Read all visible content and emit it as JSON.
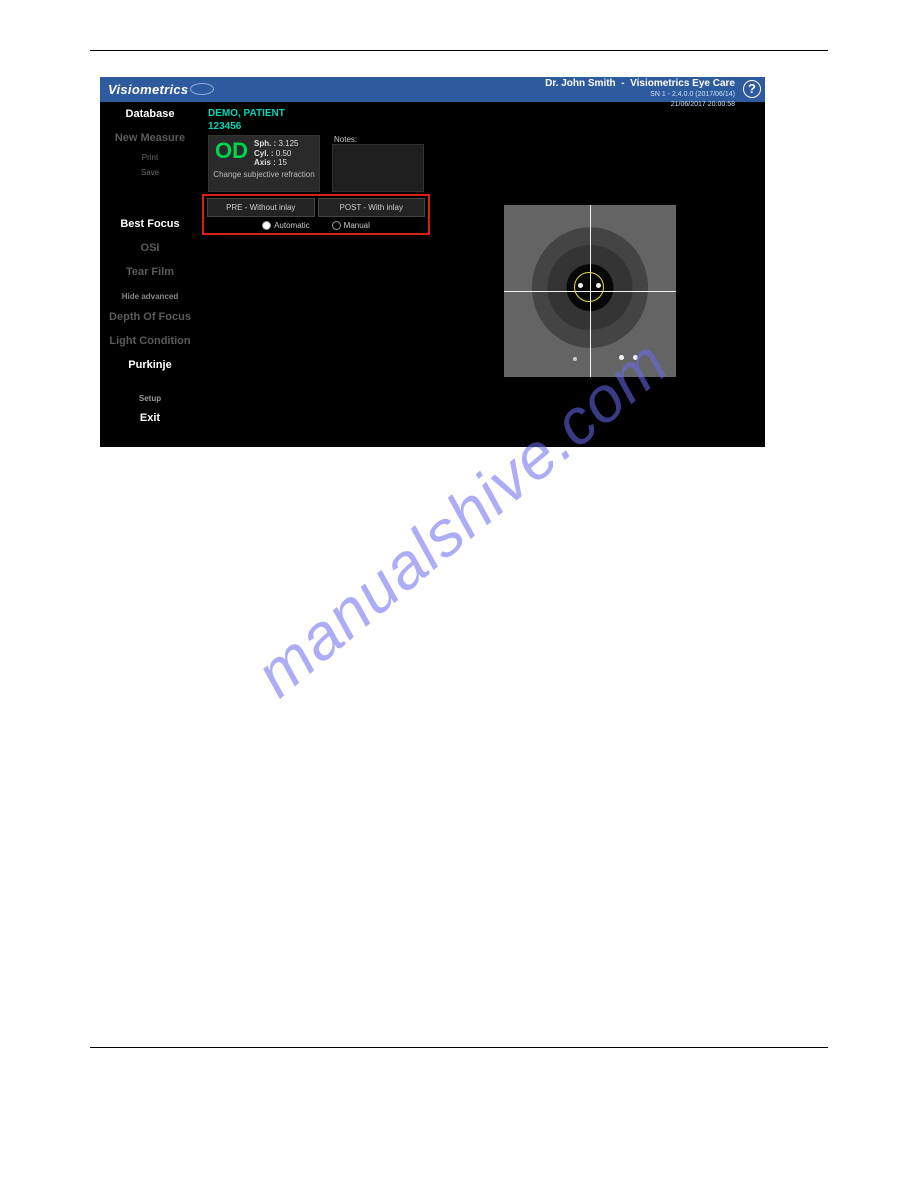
{
  "titlebar": {
    "brand": "Visiometrics",
    "doctor": "Dr. John Smith",
    "clinic": "Visiometrics Eye Care",
    "version": "SN 1 - 2.4.0.0 (2017/06/14)",
    "datetime": "21/06/2017 20:00:58"
  },
  "sidebar": {
    "database": "Database",
    "new_measure": "New Measure",
    "print": "Print",
    "save": "Save",
    "best_focus": "Best Focus",
    "osi": "OSI",
    "tear_film": "Tear Film",
    "hide_advanced": "Hide advanced",
    "depth_of_focus": "Depth Of Focus",
    "light_condition": "Light Condition",
    "purkinje": "Purkinje",
    "setup": "Setup",
    "exit": "Exit"
  },
  "patient": {
    "name": "DEMO, PATIENT",
    "id": "123456"
  },
  "refraction": {
    "eye": "OD",
    "sph_label": "Sph. :",
    "sph": "3.125",
    "cyl_label": "Cyl. :",
    "cyl": "0.50",
    "axis_label": "Axis :",
    "axis": "15",
    "change": "Change subjective refraction",
    "notes_label": "Notes:"
  },
  "inlay": {
    "pre": "PRE - Without inlay",
    "post": "POST - With inlay",
    "automatic": "Automatic",
    "manual": "Manual"
  },
  "help": "?",
  "watermark": "manualshive.com"
}
